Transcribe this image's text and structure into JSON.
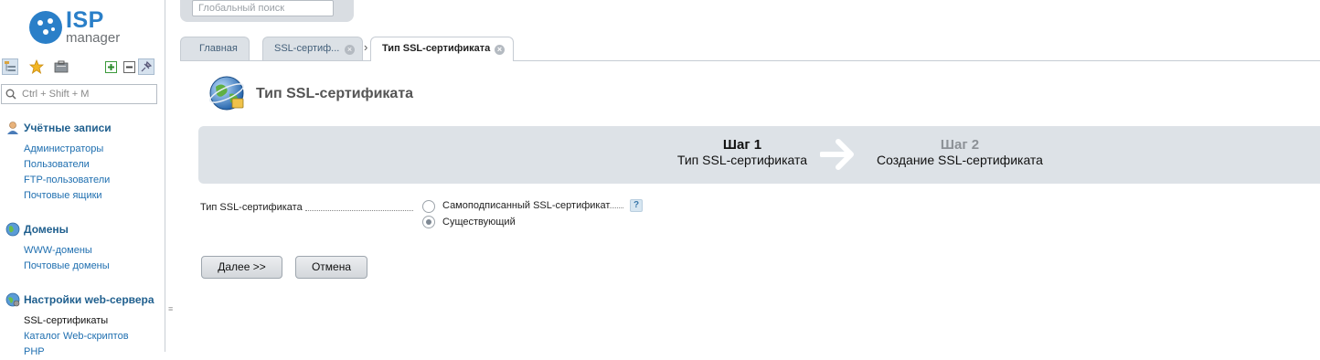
{
  "app": {
    "logo_isp": "ISP",
    "logo_manager": "manager",
    "brand_color": "#2a7fc8"
  },
  "toolbar": {
    "icons": [
      "tree-view-icon",
      "favorites-star-icon",
      "briefcase-icon",
      "expand-all-icon",
      "collapse-all-icon",
      "pin-icon"
    ]
  },
  "sidebar": {
    "search_placeholder": "Ctrl + Shift + M",
    "groups": [
      {
        "title": "Учётные записи",
        "icon": "users-icon",
        "items": [
          "Администраторы",
          "Пользователи",
          "FTP-пользователи",
          "Почтовые ящики"
        ]
      },
      {
        "title": "Домены",
        "icon": "globe-icon",
        "items": [
          "WWW-домены",
          "Почтовые домены"
        ]
      },
      {
        "title": "Настройки web-сервера",
        "icon": "web-settings-icon",
        "items": [
          "SSL-сертификаты",
          "Каталог Web-скриптов",
          "PHP"
        ],
        "current_item": "SSL-сертификаты"
      }
    ]
  },
  "header": {
    "global_search_placeholder": "Глобальный поиск"
  },
  "tabs": [
    {
      "label": "Главная",
      "closable": false
    },
    {
      "label": "SSL-сертиф...",
      "closable": true
    },
    {
      "label": "Тип SSL-сертификата",
      "closable": true,
      "active": true
    }
  ],
  "main": {
    "title": "Тип SSL-сертификата",
    "wizard": {
      "step1_number": "Шаг 1",
      "step1_desc": "Тип SSL-сертификата",
      "step2_number": "Шаг 2",
      "step2_desc": "Создание SSL-сертификата",
      "current_step": 1
    },
    "form": {
      "field_label": "Тип SSL-сертификата",
      "options": [
        "Самоподписанный SSL-сертификат",
        "Существующий"
      ],
      "selected": "Существующий",
      "help": "?"
    },
    "buttons": {
      "next": "Далее >>",
      "cancel": "Отмена"
    }
  }
}
